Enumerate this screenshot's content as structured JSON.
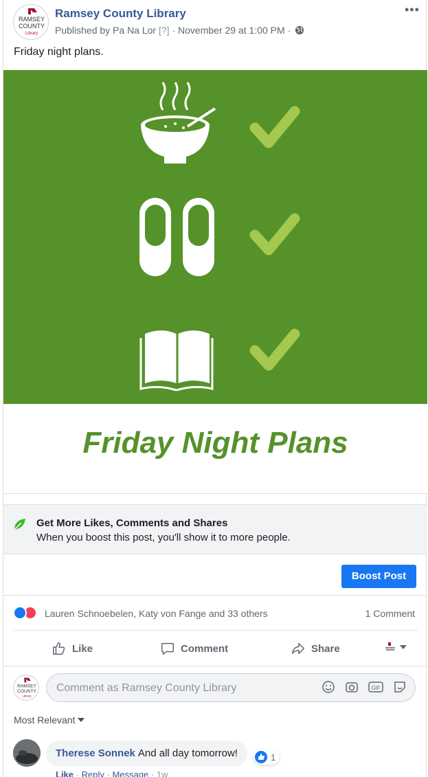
{
  "post": {
    "page_name": "Ramsey County Library",
    "logo_text": [
      "RAMSEY",
      "COUNTY",
      "Library"
    ],
    "published_by_prefix": "Published by",
    "publisher": "Pa Na Lor",
    "help_marker": "[?]",
    "timestamp": "November 29 at 1:00 PM",
    "separator": "·",
    "privacy_icon": "globe-icon",
    "more_icon": "ellipsis-icon",
    "more_label": "•••",
    "caption": "Friday night plans."
  },
  "image": {
    "title": "Friday Night Plans",
    "icons": [
      "soup-bowl-icon",
      "slippers-icon",
      "open-book-icon"
    ],
    "check_icon": "checkmark-icon",
    "background_color": "#55922a",
    "check_color": "#a4c94e"
  },
  "boost": {
    "title": "Get More Likes, Comments and Shares",
    "subtitle": "When you boost this post, you'll show it to more people.",
    "button_label": "Boost Post",
    "button_color": "#1877f2"
  },
  "engagement": {
    "reaction_icons": [
      "like-reaction-icon",
      "love-reaction-icon"
    ],
    "reaction_names": "Lauren Schnoebelen, Katy von Fange and 33 others",
    "comment_count": "1 Comment"
  },
  "actions": {
    "like": "Like",
    "comment": "Comment",
    "share": "Share"
  },
  "composer": {
    "placeholder": "Comment as Ramsey County Library",
    "icons": [
      "emoji-icon",
      "camera-icon",
      "gif-icon",
      "sticker-icon"
    ],
    "gif_label": "GIF"
  },
  "comments_filter": {
    "label": "Most Relevant"
  },
  "comments": [
    {
      "author": "Therese Sonnek",
      "text": "And all day tomorrow!",
      "reaction_count": "1",
      "actions": [
        "Like",
        "Reply",
        "Message"
      ],
      "age": "1w"
    }
  ]
}
